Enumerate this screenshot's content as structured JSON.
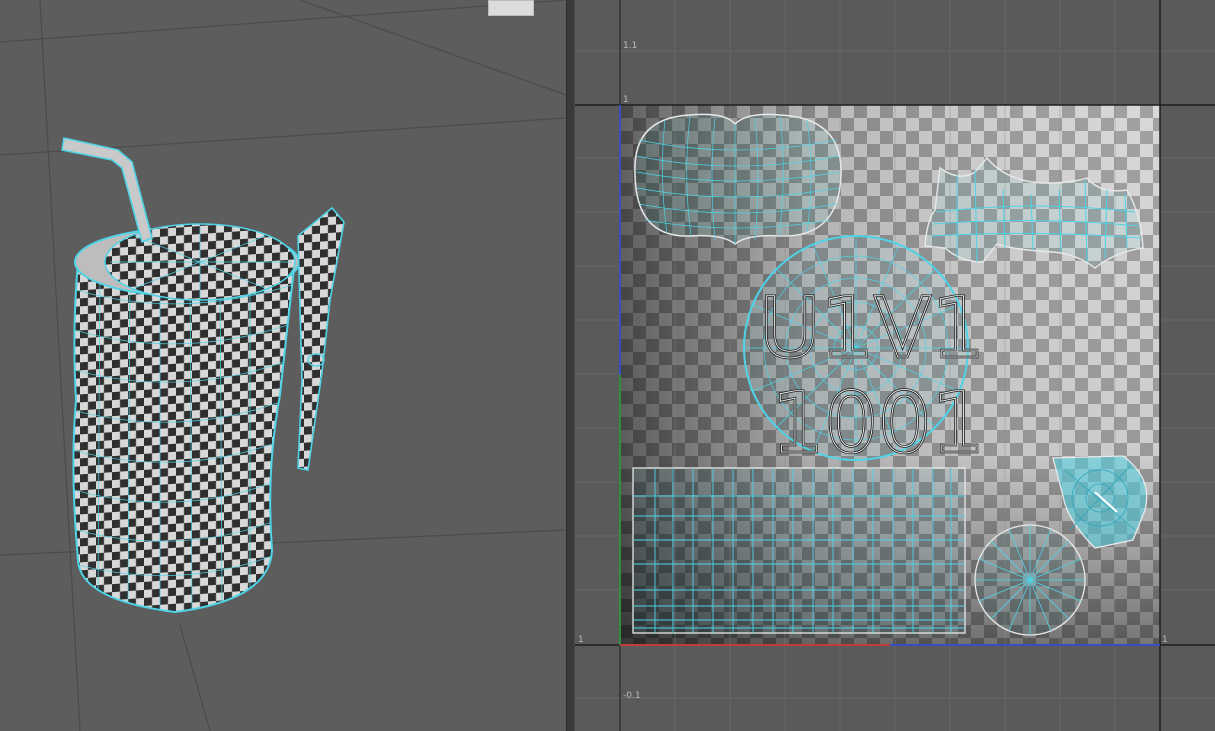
{
  "viewport": {
    "left_panel": "3d-viewport",
    "right_panel": "uv-editor",
    "corner_chip_text": ""
  },
  "uv_editor": {
    "axis_labels": {
      "v_top": "1.1",
      "v_one": "1",
      "u_zero_left": "1",
      "u_one_right": "1",
      "v_neg": "-0.1"
    },
    "tile_label_line1": "U1V1",
    "tile_label_line2": "1001"
  },
  "colors": {
    "wire": "#4fd3e6",
    "checker_dark": "#4a4a4a",
    "checker_light": "#d6d6d6",
    "grid": "#6a6a6a",
    "u_axis": "#c23b3b",
    "v_axis": "#2f8f3f",
    "edge_blue": "#3a4fbf"
  }
}
